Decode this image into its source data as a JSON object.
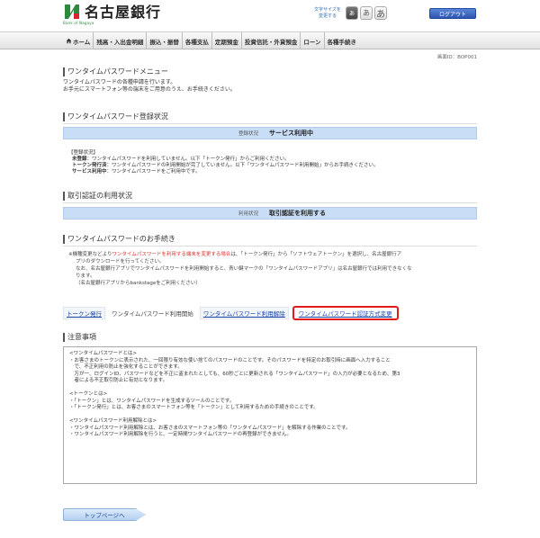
{
  "header": {
    "bank_name": "名古屋銀行",
    "bank_sub": "Bank of Nagoya",
    "font_size_label": "文字サイズを変更する",
    "font_sizes": [
      "あ",
      "あ",
      "あ"
    ],
    "logout": "ログアウト",
    "colors": {
      "brand_green": "#2a8a3e",
      "logout_blue": "#2c56b0"
    }
  },
  "nav": {
    "items": [
      "ホーム",
      "残高・入出金明細",
      "振込・振替",
      "各種支払",
      "定期預金",
      "投資信託・外貨預金",
      "ローン",
      "各種手続き"
    ]
  },
  "screen_id": "画面ID：BOP001",
  "menu": {
    "title": "ワンタイムパスワードメニュー",
    "desc": [
      "ワンタイムパスワードの各種申請を行います。",
      "お手元にスマートフォン等の端末をご用意のうえ、お手続きください。"
    ]
  },
  "reg_status": {
    "title": "ワンタイムパスワード登録状況",
    "label": "登録状況",
    "value": "サービス利用中",
    "legend_head": "【登録状況】",
    "legend": [
      {
        "term": "未登録",
        "text": "：ワンタイムパスワードを利用していません。以下「トークン発行」からご利用ください。"
      },
      {
        "term": "トークン発行済",
        "text": "：ワンタイムパスワードの利用開始が完了していません。以下「ワンタイムパスワード利用開始」からお手続きください。"
      },
      {
        "term": "サービス利用中",
        "text": "：ワンタイムパスワードをご利用中です。"
      }
    ]
  },
  "auth_status": {
    "title": "取引認証の利用状況",
    "label": "利用状況",
    "value": "取引認証を利用する"
  },
  "procedures": {
    "title": "ワンタイムパスワードのお手続き",
    "notice": {
      "prefix": "※機種変更などより",
      "red": "ワンタイムパスワードを利用する端末を変更する場合",
      "rest1": "は、「トークン発行」から「ソフトウェアトークン」を選択し、名古屋銀行ア",
      "line2": "プリのダウンロードを行ってください。",
      "line3": "なお、名古屋銀行アプリでワンタイムパスワードを利用開始すると、青い鍵マークの「ワンタイムパスワードアプリ」は名古屋銀行では利用できなくな",
      "line4": "ります。",
      "line5": "（名古屋銀行アプリからbankstageをご利用ください）"
    },
    "tabs": [
      "トークン発行",
      "ワンタイムパスワード利用開始",
      "ワンタイムパスワード利用解除",
      "ワンタイムパスワード認証方式変更"
    ]
  },
  "notes": {
    "title": "注意事項",
    "lines": [
      "<ワンタイムパスワードとは>",
      "・お客さまのトークンに表示された、一回限り有効な使い捨てのパスワードのことです。そのパスワードを特定のお取引時に画面へ入力すること",
      "　で、不正利用の防止を強化することができます。",
      "　万が一、ログインID、パスワードなどを不正に盗まれたとしても、60秒ごとに更新される「ワンタイムパスワード」の入力が必要となるため、第3",
      "　者による不正取引防止に有効となります。",
      "",
      "<トークンとは>",
      "・「トークン」とは、ワンタイムパスワードを生成するツールのことです。",
      "・「トークン発行」とは、お客さまのスマートフォン等を「トークン」として利用するための手続きのことです。",
      "",
      "<ワンタイムパスワード利用解除とは>",
      "・ワンタイムパスワード利用解除とは、お客さまのスマートフォン等の「ワンタイムパスワード」を解除する作業のことです。",
      "・ワンタイムパスワード利用解除を行うと、一定時間ワンタイムパスワードの再登録ができません。"
    ]
  },
  "top_button": "トップページへ"
}
